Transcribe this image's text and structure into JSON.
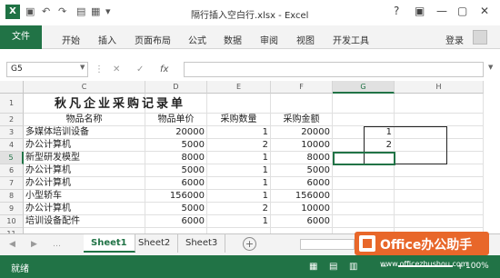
{
  "window": {
    "title": "隔行插入空白行.xlsx - Excel",
    "controls": [
      "?",
      "▣",
      "—",
      "▢",
      "✕"
    ]
  },
  "ribbon": {
    "file_label": "文件",
    "tabs": [
      "开始",
      "插入",
      "页面布局",
      "公式",
      "数据",
      "审阅",
      "视图",
      "开发工具"
    ],
    "login_label": "登录"
  },
  "formula_bar": {
    "name_box": "G5",
    "cancel_icon": "✕",
    "enter_icon": "✓",
    "fx_icon": "fx",
    "content": ""
  },
  "sheet": {
    "columns": [
      "C",
      "D",
      "E",
      "F",
      "G",
      "H"
    ],
    "selected_column": "G",
    "rows": [
      "1",
      "2",
      "3",
      "4",
      "5",
      "6",
      "7",
      "8",
      "9",
      "10",
      "11"
    ],
    "selected_row": "5",
    "title": "秋凡企业采购记录单",
    "headers": [
      "物品名称",
      "物品单价",
      "采购数量",
      "采购金额"
    ],
    "data": [
      [
        "多媒体培训设备",
        "20000",
        "1",
        "20000",
        "1"
      ],
      [
        "办公计算机",
        "5000",
        "2",
        "10000",
        "2"
      ],
      [
        "新型研发模型",
        "8000",
        "1",
        "8000",
        ""
      ],
      [
        "办公计算机",
        "5000",
        "1",
        "5000",
        ""
      ],
      [
        "办公计算机",
        "6000",
        "1",
        "6000",
        ""
      ],
      [
        "小型轿车",
        "156000",
        "1",
        "156000",
        ""
      ],
      [
        "办公计算机",
        "5000",
        "2",
        "10000",
        ""
      ],
      [
        "培训设备配件",
        "6000",
        "1",
        "6000",
        ""
      ]
    ]
  },
  "sheet_tabs": {
    "tabs": [
      "Sheet1",
      "Sheet2",
      "Sheet3"
    ],
    "active": "Sheet1",
    "add_icon": "+"
  },
  "status": {
    "ready": "就绪",
    "zoom": "100%"
  },
  "watermark": {
    "brand": "Office办公助手",
    "url": "www.officezhushou.com"
  }
}
